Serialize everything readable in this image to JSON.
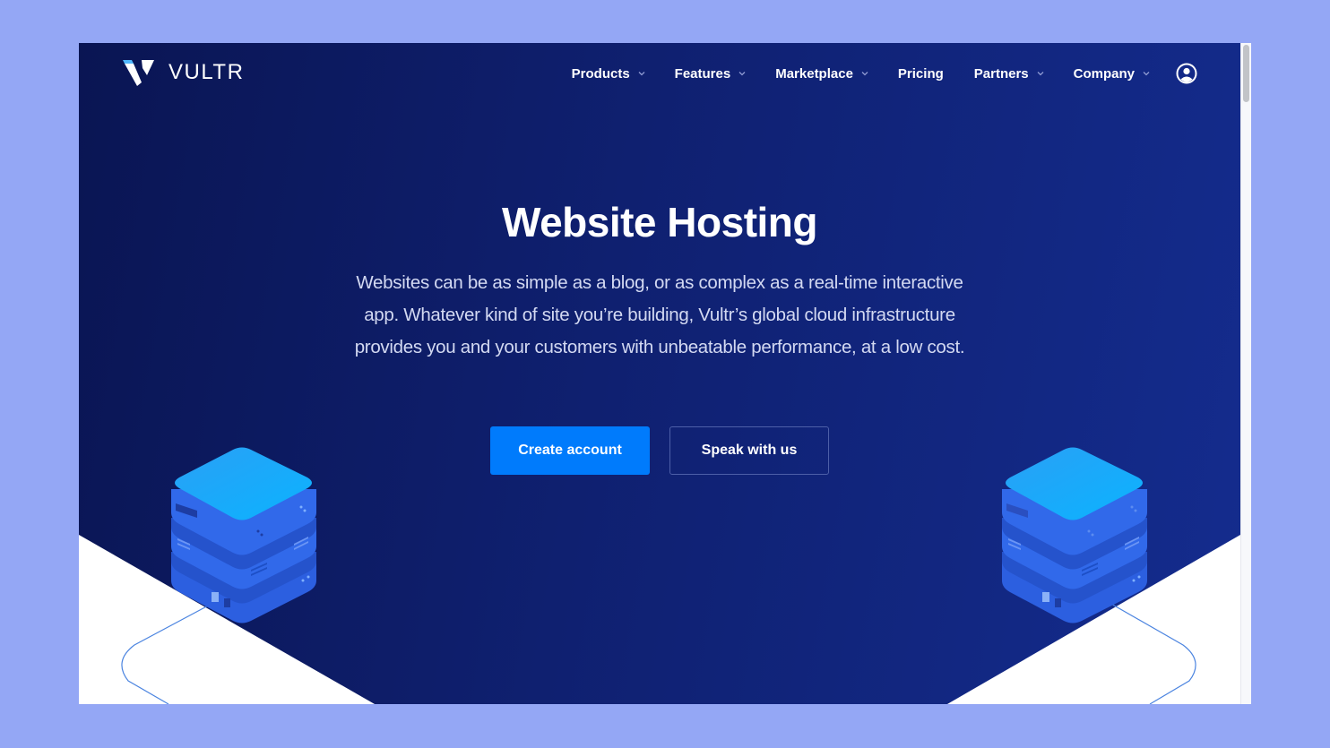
{
  "brand": {
    "name": "VULTR",
    "logo_icon": "vultr-v-logo-icon"
  },
  "nav": {
    "items": [
      {
        "label": "Products",
        "has_dropdown": true
      },
      {
        "label": "Features",
        "has_dropdown": true
      },
      {
        "label": "Marketplace",
        "has_dropdown": true
      },
      {
        "label": "Pricing",
        "has_dropdown": false
      },
      {
        "label": "Partners",
        "has_dropdown": true
      },
      {
        "label": "Company",
        "has_dropdown": true
      }
    ],
    "account_icon": "user-circle-icon"
  },
  "hero": {
    "title": "Website Hosting",
    "description": "Websites can be as simple as a blog, or as complex as a real-time interactive app. Whatever kind of site you’re building, Vultr’s global cloud infrastructure provides you and your customers with unbeatable performance, at a low cost.",
    "primary_button": "Create account",
    "secondary_button": "Speak with us"
  },
  "colors": {
    "background_frame": "#94a7f5",
    "hero_dark": "#0a1553",
    "hero_light": "#142c8e",
    "primary_button": "#007bfc",
    "server_top": "#11a3f5",
    "server_body": "#2f63e6"
  },
  "illustrations": [
    "server-stack-icon",
    "server-stack-icon"
  ]
}
